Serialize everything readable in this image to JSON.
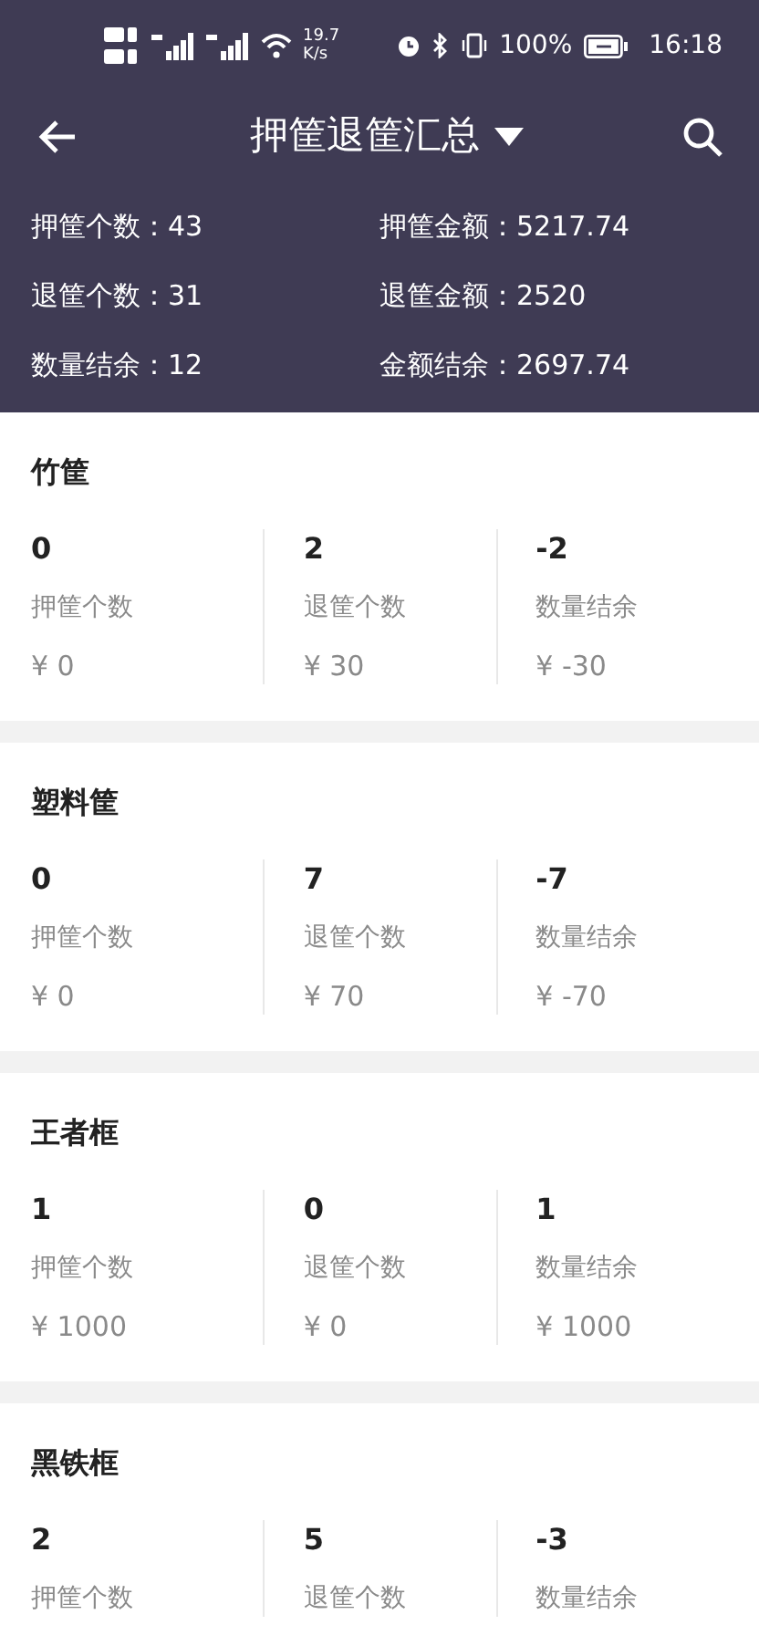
{
  "status_bar": {
    "net_speed": "19.7",
    "net_unit": "K/s",
    "battery": "100%",
    "time": "16:18"
  },
  "app_bar": {
    "title": "押筐退筐汇总"
  },
  "summary": [
    {
      "label": "押筐个数：",
      "value": "43"
    },
    {
      "label": "押筐金额：",
      "value": "5217.74"
    },
    {
      "label": "退筐个数：",
      "value": "31"
    },
    {
      "label": "退筐金额：",
      "value": "2520"
    },
    {
      "label": "数量结余：",
      "value": "12"
    },
    {
      "label": "金额结余：",
      "value": "2697.74"
    }
  ],
  "cards": [
    {
      "title": "竹筐",
      "stats": [
        {
          "count": "0",
          "label": "押筐个数",
          "amount": "¥ 0"
        },
        {
          "count": "2",
          "label": "退筐个数",
          "amount": "¥ 30"
        },
        {
          "count": "-2",
          "label": "数量结余",
          "amount": "¥ -30"
        }
      ]
    },
    {
      "title": "塑料筐",
      "stats": [
        {
          "count": "0",
          "label": "押筐个数",
          "amount": "¥ 0"
        },
        {
          "count": "7",
          "label": "退筐个数",
          "amount": "¥ 70"
        },
        {
          "count": "-7",
          "label": "数量结余",
          "amount": "¥ -70"
        }
      ]
    },
    {
      "title": "王者框",
      "stats": [
        {
          "count": "1",
          "label": "押筐个数",
          "amount": "¥ 1000"
        },
        {
          "count": "0",
          "label": "退筐个数",
          "amount": "¥ 0"
        },
        {
          "count": "1",
          "label": "数量结余",
          "amount": "¥ 1000"
        }
      ]
    },
    {
      "title": "黑铁框",
      "stats": [
        {
          "count": "2",
          "label": "押筐个数"
        },
        {
          "count": "5",
          "label": "退筐个数"
        },
        {
          "count": "-3",
          "label": "数量结余"
        }
      ]
    }
  ]
}
